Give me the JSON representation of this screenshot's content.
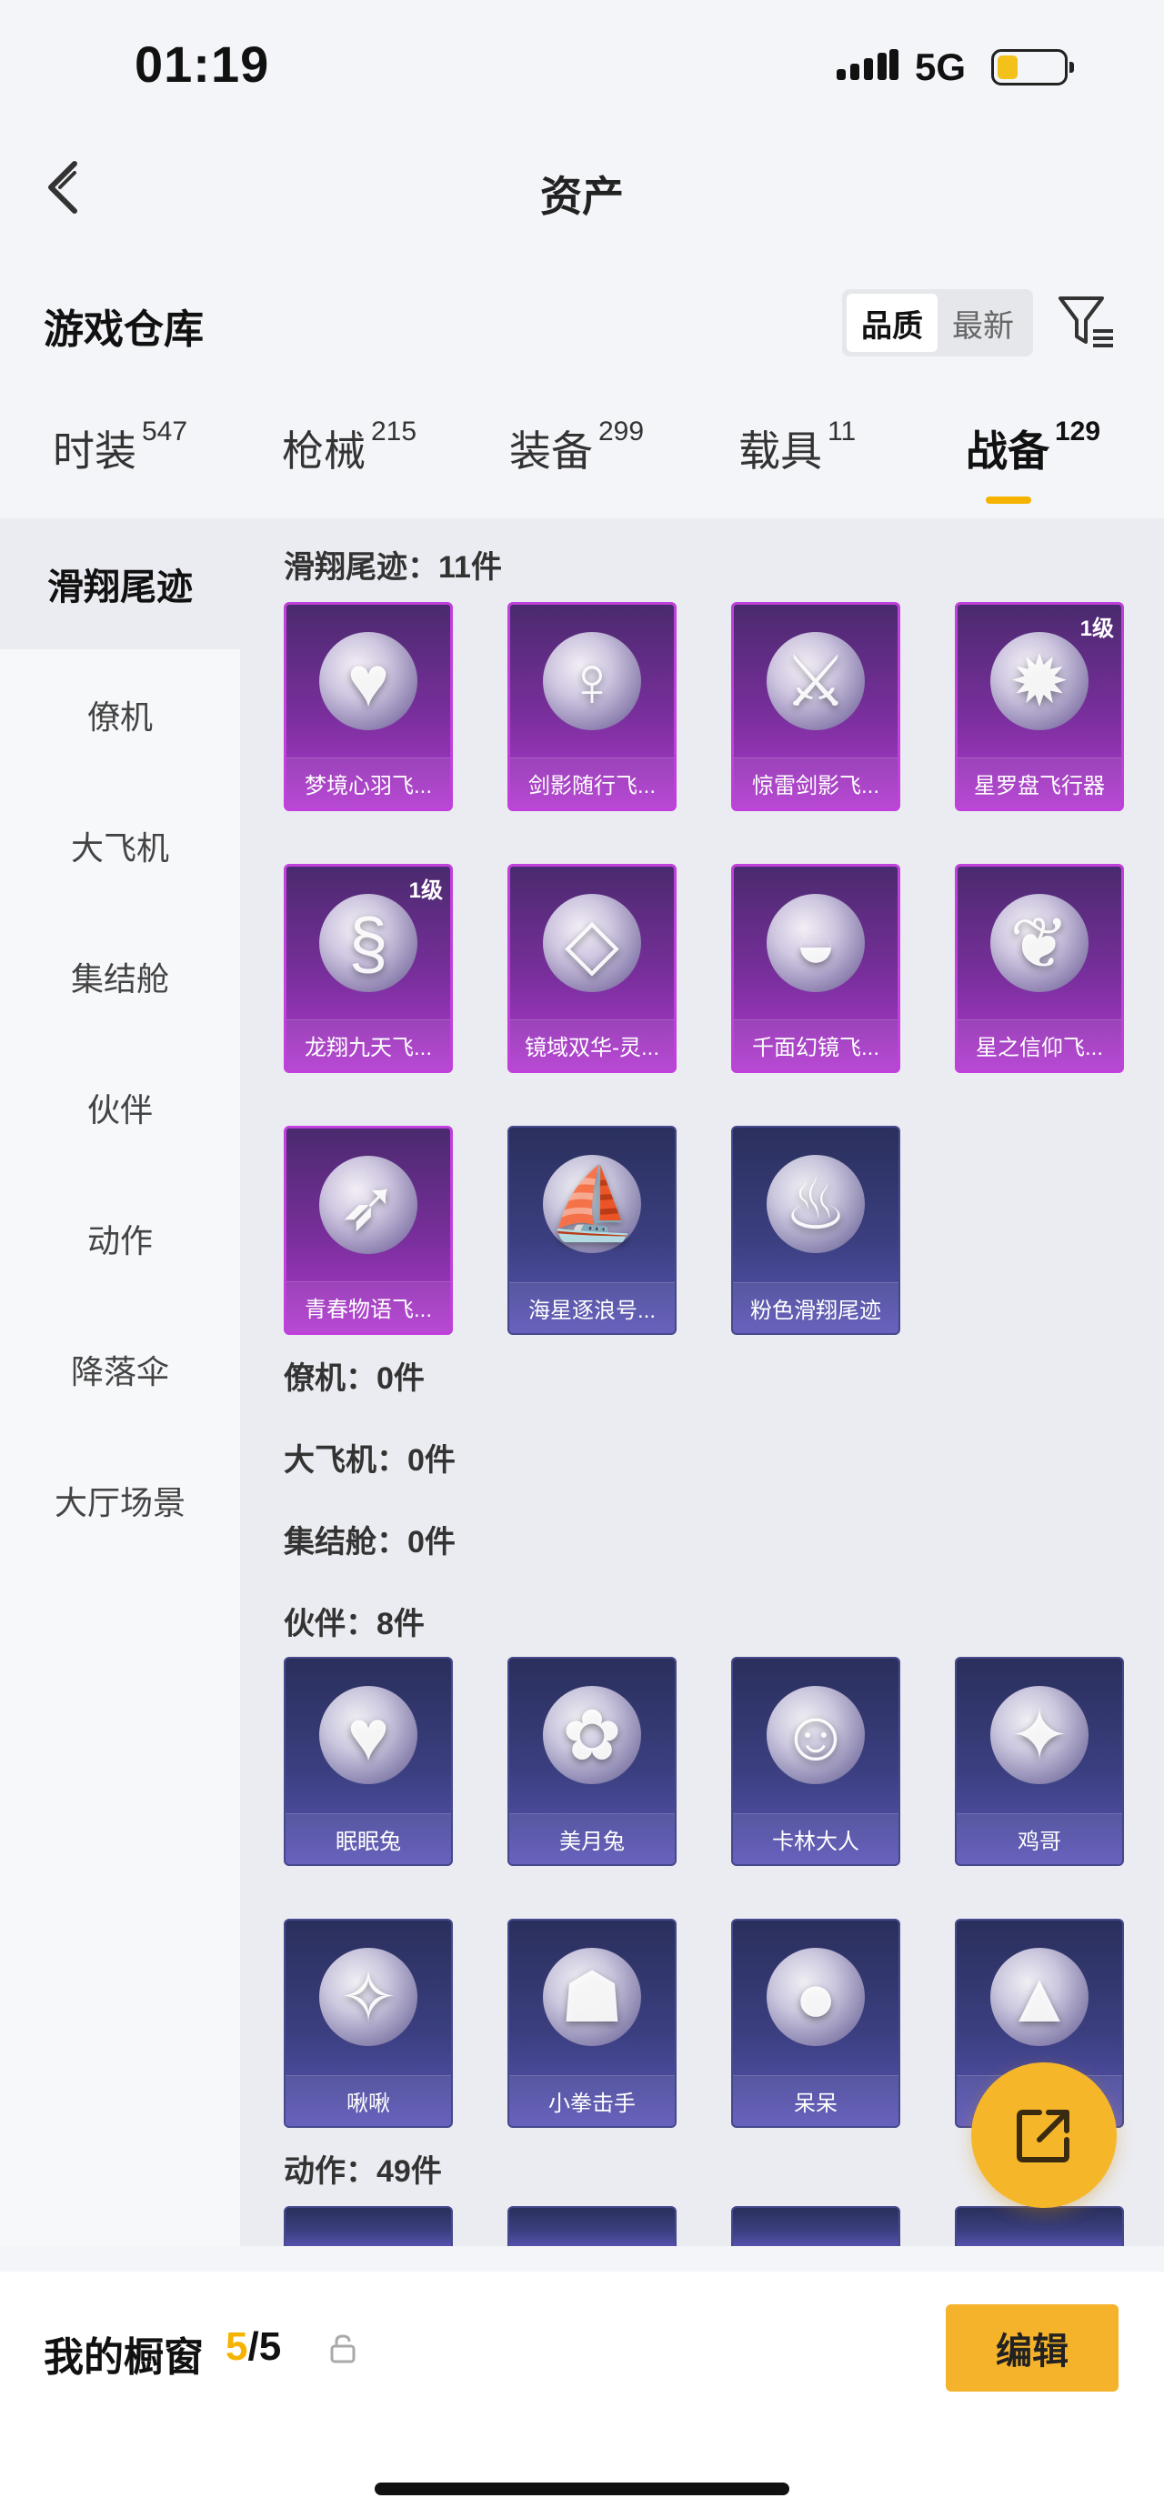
{
  "status_bar": {
    "time": "01:19",
    "network": "5G"
  },
  "nav": {
    "title": "资产"
  },
  "header": {
    "title": "游戏仓库",
    "sort_options": [
      "品质",
      "最新"
    ]
  },
  "tabs": [
    {
      "label": "时装",
      "count": "547"
    },
    {
      "label": "枪械",
      "count": "215"
    },
    {
      "label": "装备",
      "count": "299"
    },
    {
      "label": "载具",
      "count": "11"
    },
    {
      "label": "战备",
      "count": "129"
    }
  ],
  "sidebar": [
    "滑翔尾迹",
    "僚机",
    "大飞机",
    "集结舱",
    "伙伴",
    "动作",
    "降落伞",
    "大厅场景"
  ],
  "groups": {
    "glide": "滑翔尾迹：11件",
    "wingman": "僚机：0件",
    "plane": "大飞机：0件",
    "capsule": "集结舱：0件",
    "partner": "伙伴：8件",
    "action": "动作：49件"
  },
  "glide_items": [
    {
      "name": "梦境心羽飞...",
      "level": "",
      "icon": "heart-wing-icon"
    },
    {
      "name": "剑影随行飞...",
      "level": "",
      "icon": "swordsman-icon"
    },
    {
      "name": "惊雷剑影飞...",
      "level": "",
      "icon": "sword-icon"
    },
    {
      "name": "星罗盘飞行器",
      "level": "1级",
      "icon": "astrolabe-icon"
    },
    {
      "name": "龙翔九天飞...",
      "level": "1级",
      "icon": "dragon-icon"
    },
    {
      "name": "镜域双华-灵...",
      "level": "",
      "icon": "crystal-blades-icon"
    },
    {
      "name": "千面幻镜飞...",
      "level": "",
      "icon": "ufo-icon"
    },
    {
      "name": "星之信仰飞...",
      "level": "",
      "icon": "feather-wing-icon"
    },
    {
      "name": "青春物语飞...",
      "level": "",
      "icon": "glider-icon"
    },
    {
      "name": "海星逐浪号...",
      "level": "",
      "icon": "boat-icon"
    },
    {
      "name": "粉色滑翔尾迹",
      "level": "",
      "icon": "smoke-trail-icon"
    }
  ],
  "partner_items": [
    {
      "name": "眠眠兔",
      "icon": "bunny-icon"
    },
    {
      "name": "美月兔",
      "icon": "rabbit-girl-icon"
    },
    {
      "name": "卡林大人",
      "icon": "cat-icon"
    },
    {
      "name": "鸡哥",
      "icon": "chicken-icon"
    },
    {
      "name": "啾啾",
      "icon": "bird-icon"
    },
    {
      "name": "小拳击手",
      "icon": "boxer-icon"
    },
    {
      "name": "呆呆",
      "icon": "chick-icon"
    },
    {
      "name": "",
      "icon": "helmet-chicken-icon"
    }
  ],
  "showcase": {
    "label": "我的橱窗",
    "used": "5",
    "total": "/5"
  },
  "edit_label": "编辑"
}
